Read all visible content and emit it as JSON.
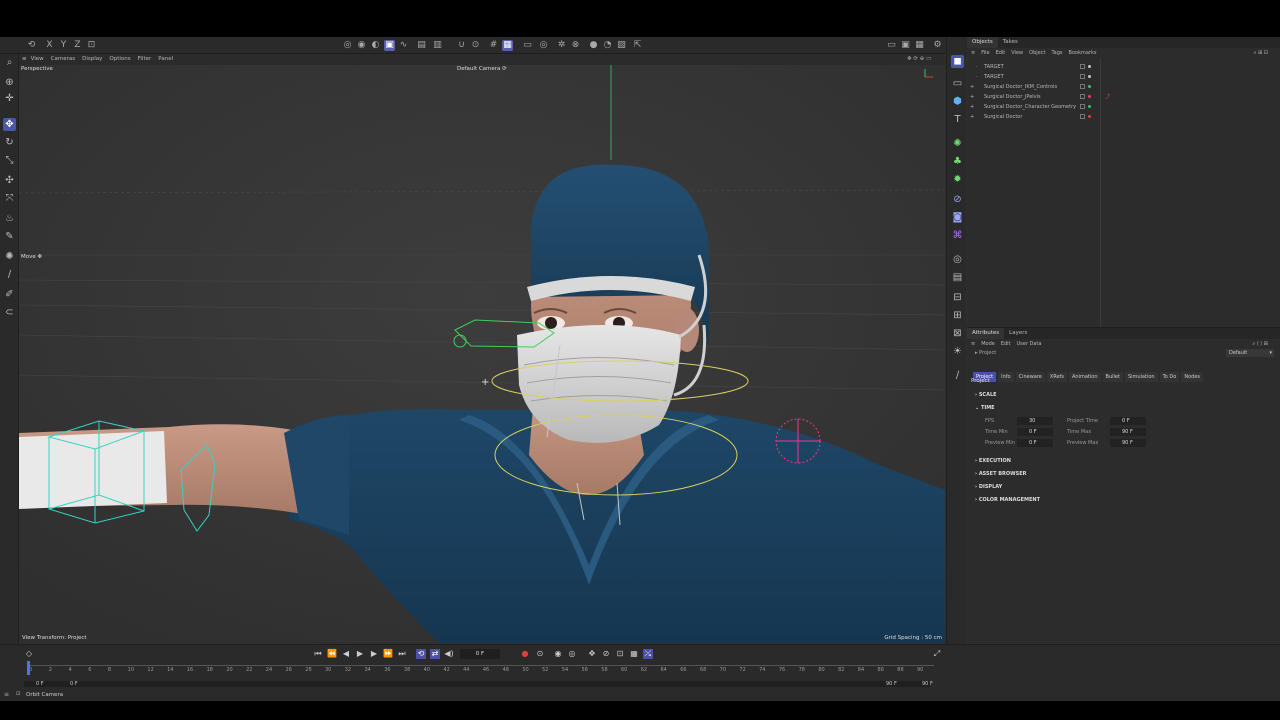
{
  "toolbar": {
    "icons": [
      "undo-icon",
      "redo-icon",
      "axis-x-icon",
      "axis-y-icon",
      "axis-z-icon",
      "coordinate-icon",
      "render-view-icon",
      "render-picture-icon",
      "edit-render-settings-icon",
      "cube-icon",
      "spline-icon",
      "generator-icon",
      "deformer-icon",
      "field-icon",
      "camera-icon",
      "light-icon",
      "material-icon",
      "snap-icon",
      "grid-icon",
      "workplane-icon",
      "layout-icon",
      "settings-icon"
    ]
  },
  "viewport": {
    "menu": [
      "View",
      "Cameras",
      "Display",
      "Options",
      "Filter",
      "Panel"
    ],
    "label": "Perspective",
    "camera": "Default Camera",
    "camera_glyph": "⟳",
    "move_label": "Move ✥",
    "view_transform": "View Transform: Project",
    "grid_spacing": "Grid Spacing : 50 cm"
  },
  "objects": {
    "tabs": [
      "Objects",
      "Takes"
    ],
    "menu": [
      "File",
      "Edit",
      "View",
      "Object",
      "Tags",
      "Bookmarks"
    ],
    "items": [
      {
        "name": "TARGET",
        "dot": "#c5c5c5"
      },
      {
        "name": "TARGET",
        "dot": "#c5c5c5"
      },
      {
        "name": "Surgical Doctor_IKM_Controls",
        "dot": "#3bbf6f"
      },
      {
        "name": "Surgical Doctor_JPelvis",
        "dot": "#e04070"
      },
      {
        "name": "Surgical Doctor_Character Geometry",
        "dot": "#3bbf6f"
      },
      {
        "name": "Surgical Doctor",
        "dot": "#e04040"
      }
    ]
  },
  "attributes": {
    "tabs": [
      "Attributes",
      "Layers"
    ],
    "menu": [
      "Mode",
      "Edit",
      "User Data"
    ],
    "object_label": "Project",
    "preset": "Default",
    "chips": [
      "Project",
      "Info",
      "Cineware",
      "XRefs",
      "Animation",
      "Bullet",
      "Simulation",
      "To Do",
      "Nodes"
    ],
    "heading": "Project",
    "sections": {
      "scale": "SCALE",
      "time": "TIME",
      "execution": "EXECUTION",
      "asset": "ASSET BROWSER",
      "display": "DISPLAY",
      "color": "COLOR MANAGEMENT"
    },
    "fields": {
      "fps_label": "FPS",
      "fps": "30",
      "time_min_label": "Time Min",
      "time_min": "0 F",
      "preview_min_label": "Preview Min",
      "preview_min": "0 F",
      "project_time_label": "Project Time",
      "project_time": "0 F",
      "time_max_label": "Time Max",
      "time_max": "90 F",
      "preview_max_label": "Preview Max",
      "preview_max": "90 F"
    }
  },
  "timeline": {
    "current_frame": "0 F",
    "ticks": [
      "0",
      "2",
      "4",
      "6",
      "8",
      "10",
      "12",
      "14",
      "16",
      "18",
      "20",
      "22",
      "24",
      "26",
      "28",
      "30",
      "32",
      "34",
      "36",
      "38",
      "40",
      "42",
      "44",
      "46",
      "48",
      "50",
      "52",
      "54",
      "56",
      "58",
      "60",
      "62",
      "64",
      "66",
      "68",
      "70",
      "72",
      "74",
      "76",
      "78",
      "80",
      "82",
      "84",
      "86",
      "88",
      "90"
    ],
    "range_start": "0 F",
    "range_start2": "0 F",
    "range_end": "90 F",
    "range_end2": "90 F"
  },
  "status": {
    "text": "Orbit Camera"
  },
  "colors": {
    "accent": "#4d50a6",
    "scrubs": "#1b3f5e",
    "ik": "#32d4c4",
    "ring": "#d8d060",
    "selection": "#ff3090"
  }
}
